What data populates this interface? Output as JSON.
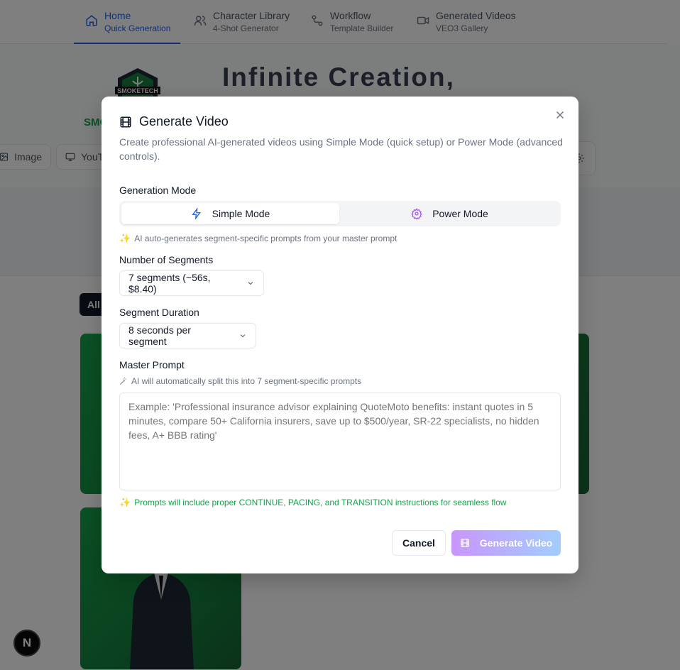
{
  "nav": {
    "tabs": [
      {
        "title": "Home",
        "subtitle": "Quick Generation",
        "icon": "home-icon"
      },
      {
        "title": "Character Library",
        "subtitle": "4-Shot Generator",
        "icon": "users-icon"
      },
      {
        "title": "Workflow",
        "subtitle": "Template Builder",
        "icon": "workflow-icon"
      },
      {
        "title": "Generated Videos",
        "subtitle": "VEO3 Gallery",
        "icon": "video-icon"
      }
    ]
  },
  "hero": {
    "logo_text": "SMOKETECH",
    "title": "Infinite Creation,",
    "brand_small": "SMC",
    "chip_image": "Image",
    "chip_youtube": "YouT",
    "filter_all": "All"
  },
  "dialog": {
    "title": "Generate Video",
    "description": "Create professional AI-generated videos using Simple Mode (quick setup) or Power Mode (advanced controls).",
    "generation_mode_label": "Generation Mode",
    "simple_mode": "Simple Mode",
    "power_mode": "Power Mode",
    "mode_hint": "AI auto-generates segment-specific prompts from your master prompt",
    "segments_label": "Number of Segments",
    "segments_value": "7 segments (~56s, $8.40)",
    "duration_label": "Segment Duration",
    "duration_value": "8 seconds per segment",
    "master_prompt_label": "Master Prompt",
    "master_prompt_hint": "AI will automatically split this into 7 segment-specific prompts",
    "master_prompt_placeholder": "Example: 'Professional insurance advisor explaining QuoteMoto benefits: instant quotes in 5 minutes, compare 50+ California insurers, save up to $500/year, SR-22 specialists, no hidden fees, A+ BBB rating'",
    "master_prompt_value": "",
    "transition_hint": "Prompts will include proper CONTINUE, PACING, and TRANSITION instructions for seamless flow",
    "cancel_label": "Cancel",
    "generate_label": "Generate Video"
  },
  "colors": {
    "accent_blue": "#2563eb",
    "brand_green": "#16a34a",
    "power_purple": "#a855f7",
    "sparkle_orange": "#f59e0b"
  }
}
